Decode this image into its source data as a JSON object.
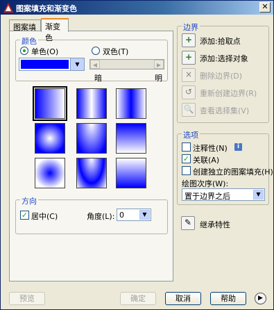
{
  "window": {
    "title": "图案填充和渐变色"
  },
  "tabs": {
    "hatch": "图案填充",
    "gradient": "渐变色"
  },
  "color": {
    "group_title": "颜色",
    "single_label": "单色(O)",
    "double_label": "双色(T)",
    "color_value": "#0000ff",
    "shade_dark": "暗",
    "shade_light": "明"
  },
  "gradients": {
    "patterns": [
      "linear",
      "cylinder",
      "inv-cylinder",
      "spherical",
      "hemispherical",
      "curved",
      "inv-spherical",
      "inv-hemispherical",
      "inv-curved"
    ],
    "selected_index": 0
  },
  "orientation": {
    "group_title": "方向",
    "centered_label": "居中(C)",
    "angle_label": "角度(L):",
    "angle_value": "0"
  },
  "boundary": {
    "group_title": "边界",
    "add_pick_points": "添加:拾取点",
    "add_select_objects": "添加:选择对象",
    "remove_boundaries": "删除边界(D)",
    "recreate_boundary": "重新创建边界(R)",
    "view_selections": "查看选择集(V)"
  },
  "options": {
    "group_title": "选项",
    "annotative_label": "注释性(N)",
    "associative_label": "关联(A)",
    "separate_label": "创建独立的图案填充(H)",
    "draw_order_label": "绘图次序(W):",
    "draw_order_value": "置于边界之后"
  },
  "inherit": {
    "label": "继承特性"
  },
  "footer": {
    "preview": "预览",
    "ok": "确定",
    "cancel": "取消",
    "help": "帮助"
  }
}
